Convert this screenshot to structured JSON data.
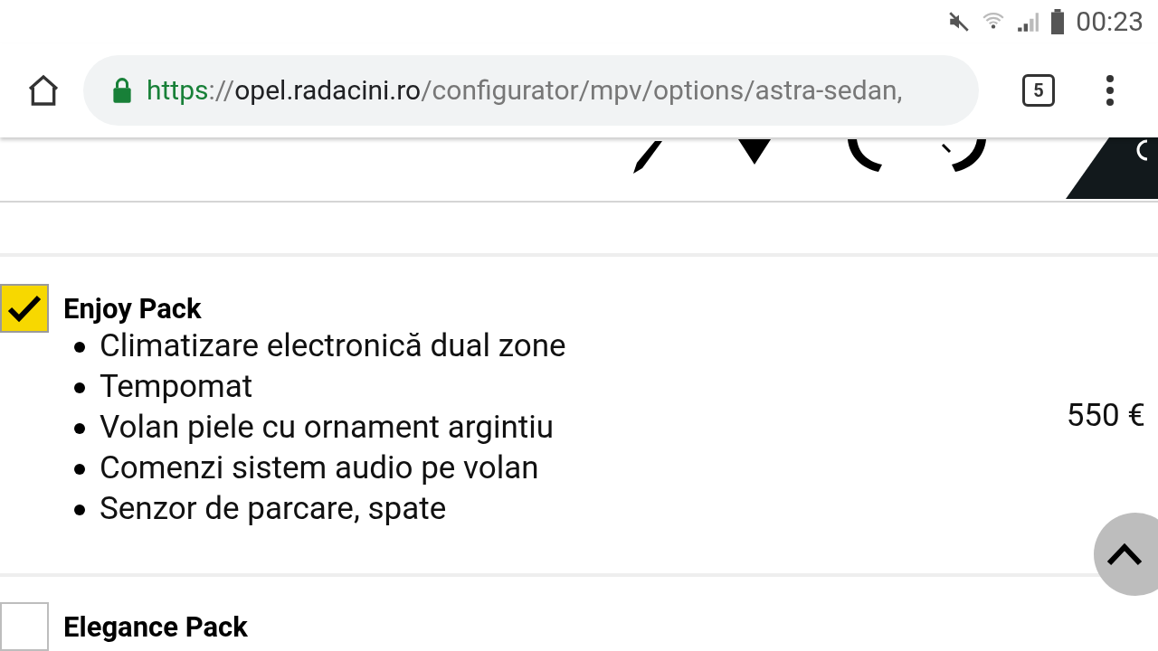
{
  "status_bar": {
    "time": "00:23"
  },
  "browser": {
    "url": {
      "scheme": "https",
      "separator": "://",
      "host": "opel.radacini.ro",
      "path": "/configurator/mpv/options/astra-sedan,"
    },
    "tab_count": "5"
  },
  "packs": [
    {
      "name": "Enjoy Pack",
      "checked": true,
      "features": [
        "Climatizare electronică dual zone",
        "Tempomat",
        "Volan piele cu ornament argintiu",
        "Comenzi sistem audio pe volan",
        "Senzor de parcare, spate"
      ],
      "price": "550 €"
    },
    {
      "name": "Elegance Pack",
      "checked": false
    }
  ]
}
